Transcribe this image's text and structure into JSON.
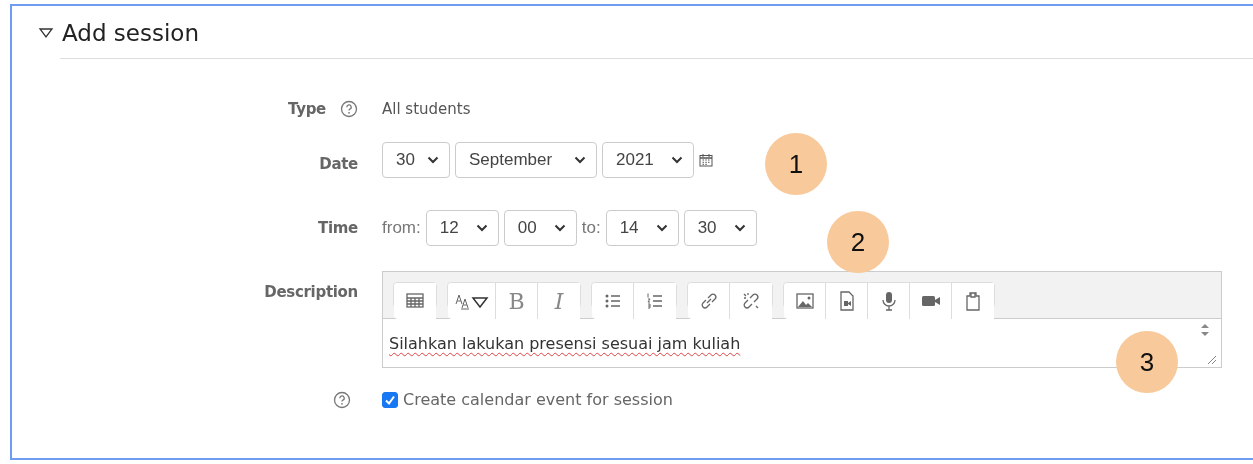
{
  "section": {
    "title": "Add session",
    "expanded": true
  },
  "type": {
    "label": "Type",
    "value": "All students"
  },
  "date": {
    "label": "Date",
    "day": "30",
    "month": "September",
    "year": "2021"
  },
  "time": {
    "label": "Time",
    "from_label": "from:",
    "from_hour": "12",
    "from_minute": "00",
    "to_label": "to:",
    "to_hour": "14",
    "to_minute": "30"
  },
  "description": {
    "label": "Description",
    "bold_label": "B",
    "italic_label": "I",
    "text": "Silahkan lakukan presensi sesuai jam kuliah"
  },
  "calendar_event": {
    "label": "Create calendar event for session",
    "checked": true
  },
  "callouts": [
    "1",
    "2",
    "3"
  ]
}
